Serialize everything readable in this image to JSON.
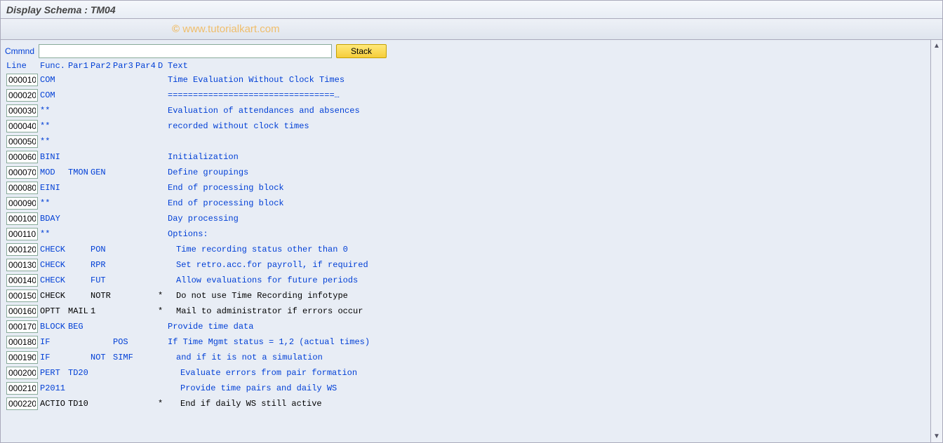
{
  "title": "Display Schema : TM04",
  "watermark": {
    "copy": "©",
    "text": "www.tutorialkart.com"
  },
  "cmd": {
    "label": "Cmmnd",
    "value": "",
    "stack": "Stack"
  },
  "hdr": {
    "line": "Line",
    "func": "Func.",
    "par1": "Par1",
    "par2": "Par2",
    "par3": "Par3",
    "par4": "Par4",
    "d": "D",
    "text": "Text"
  },
  "rows": [
    {
      "line": "000010",
      "cls": "blue",
      "func": "COM",
      "par1": "",
      "par2": "",
      "par3": "",
      "par4": "",
      "d": "",
      "text": "Time Evaluation Without Clock Times",
      "indent": 0
    },
    {
      "line": "000020",
      "cls": "blue",
      "func": "COM",
      "par1": "",
      "par2": "",
      "par3": "",
      "par4": "",
      "d": "",
      "text": "=================================…",
      "indent": 0
    },
    {
      "line": "000030",
      "cls": "blue",
      "func": "**",
      "par1": "",
      "par2": "",
      "par3": "",
      "par4": "",
      "d": "",
      "text": "Evaluation of attendances and absences",
      "indent": 0
    },
    {
      "line": "000040",
      "cls": "blue",
      "func": "**",
      "par1": "",
      "par2": "",
      "par3": "",
      "par4": "",
      "d": "",
      "text": "recorded without clock times",
      "indent": 0
    },
    {
      "line": "000050",
      "cls": "blue",
      "func": "**",
      "par1": "",
      "par2": "",
      "par3": "",
      "par4": "",
      "d": "",
      "text": "",
      "indent": 0
    },
    {
      "line": "000060",
      "cls": "blue",
      "func": "BINI",
      "par1": "",
      "par2": "",
      "par3": "",
      "par4": "",
      "d": "",
      "text": "Initialization",
      "indent": 0
    },
    {
      "line": "000070",
      "cls": "blue",
      "func": "MOD",
      "par1": "TMON",
      "par2": "GEN",
      "par3": "",
      "par4": "",
      "d": "",
      "text": "Define groupings",
      "indent": 0
    },
    {
      "line": "000080",
      "cls": "blue",
      "func": "EINI",
      "par1": "",
      "par2": "",
      "par3": "",
      "par4": "",
      "d": "",
      "text": "End of processing block",
      "indent": 0
    },
    {
      "line": "000090",
      "cls": "blue",
      "func": "**",
      "par1": "",
      "par2": "",
      "par3": "",
      "par4": "",
      "d": "",
      "text": "End of processing block",
      "indent": 0
    },
    {
      "line": "000100",
      "cls": "blue",
      "func": "BDAY",
      "par1": "",
      "par2": "",
      "par3": "",
      "par4": "",
      "d": "",
      "text": "Day processing",
      "indent": 0
    },
    {
      "line": "000110",
      "cls": "blue",
      "func": "**",
      "par1": "",
      "par2": "",
      "par3": "",
      "par4": "",
      "d": "",
      "text": "Options:",
      "indent": 0
    },
    {
      "line": "000120",
      "cls": "blue",
      "func": "CHECK",
      "par1": "",
      "par2": "PON",
      "par3": "",
      "par4": "",
      "d": "",
      "text": "Time recording status other than 0",
      "indent": 1
    },
    {
      "line": "000130",
      "cls": "blue",
      "func": "CHECK",
      "par1": "",
      "par2": "RPR",
      "par3": "",
      "par4": "",
      "d": "",
      "text": "Set retro.acc.for payroll, if required",
      "indent": 1
    },
    {
      "line": "000140",
      "cls": "blue",
      "func": "CHECK",
      "par1": "",
      "par2": "FUT",
      "par3": "",
      "par4": "",
      "d": "",
      "text": "Allow evaluations for future periods",
      "indent": 1
    },
    {
      "line": "000150",
      "cls": "black",
      "func": "CHECK",
      "par1": "",
      "par2": "NOTR",
      "par3": "",
      "par4": "",
      "d": "*",
      "text": "Do not use Time Recording infotype",
      "indent": 1
    },
    {
      "line": "000160",
      "cls": "black",
      "func": "OPTT",
      "par1": "MAIL",
      "par2": "1",
      "par3": "",
      "par4": "",
      "d": "*",
      "text": "Mail to administrator if errors occur",
      "indent": 1
    },
    {
      "line": "000170",
      "cls": "blue",
      "func": "BLOCK",
      "par1": "BEG",
      "par2": "",
      "par3": "",
      "par4": "",
      "d": "",
      "text": "Provide time data",
      "indent": 0
    },
    {
      "line": "000180",
      "cls": "blue",
      "func": "IF",
      "par1": "",
      "par2": "",
      "par3": "POS",
      "par4": "",
      "d": "",
      "text": "If Time Mgmt status = 1,2 (actual times)",
      "indent": 0
    },
    {
      "line": "000190",
      "cls": "blue",
      "func": "IF",
      "par1": "",
      "par2": "NOT",
      "par3": "SIMF",
      "par4": "",
      "d": "",
      "text": "and if it is not a simulation",
      "indent": 1
    },
    {
      "line": "000200",
      "cls": "blue",
      "func": "PERT",
      "par1": "TD20",
      "par2": "",
      "par3": "",
      "par4": "",
      "d": "",
      "text": "Evaluate errors from pair formation",
      "indent": 2
    },
    {
      "line": "000210",
      "cls": "blue",
      "func": "P2011",
      "par1": "",
      "par2": "",
      "par3": "",
      "par4": "",
      "d": "",
      "text": "Provide time pairs and daily WS",
      "indent": 2
    },
    {
      "line": "000220",
      "cls": "black",
      "func": "ACTIO",
      "par1": "TD10",
      "par2": "",
      "par3": "",
      "par4": "",
      "d": "*",
      "text": "End if daily WS still active",
      "indent": 2
    }
  ]
}
